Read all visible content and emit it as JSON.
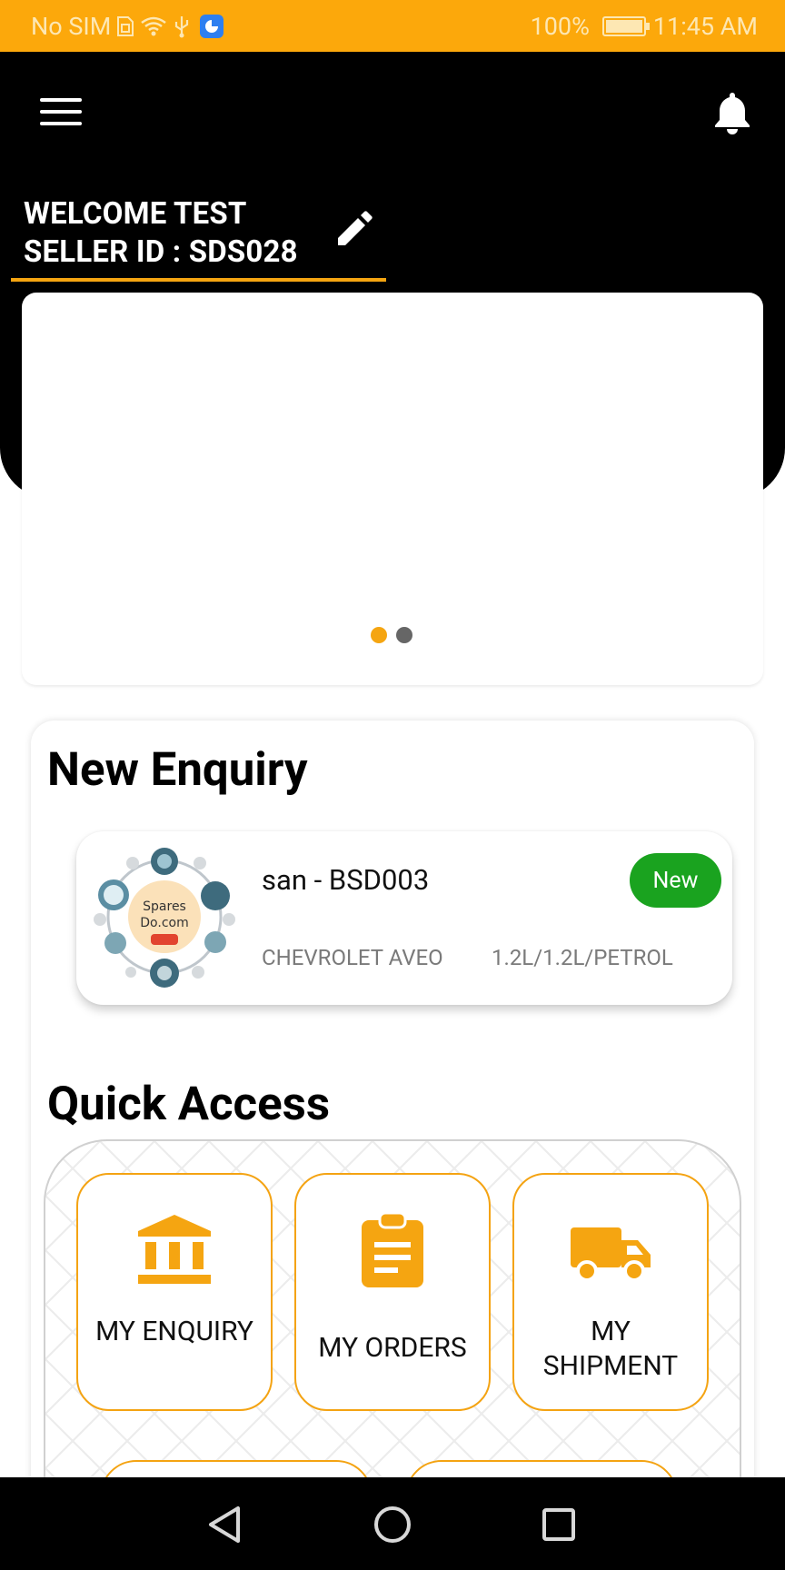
{
  "status_bar": {
    "left_text": "No SIM",
    "battery": "100%",
    "time": "11:45 AM"
  },
  "header": {
    "welcome": "WELCOME TEST",
    "seller_id": "SELLER ID : SDS028"
  },
  "banner": {
    "dots": [
      "active",
      "inactive"
    ]
  },
  "new_enquiry": {
    "title": "New Enquiry",
    "name": "san - BSD003",
    "vehicle": "CHEVROLET AVEO",
    "engine": "1.2L/1.2L/PETROL",
    "badge": "New",
    "logo_text": "Spares Do.com"
  },
  "quick_access": {
    "title": "Quick Access",
    "tiles": [
      {
        "label": "MY ENQUIRY",
        "icon": "bank-icon"
      },
      {
        "label": "MY ORDERS",
        "icon": "clipboard-icon"
      },
      {
        "label": "MY SHIPMENT",
        "icon": "truck-icon"
      }
    ]
  },
  "nav": {
    "buttons": [
      "back-icon",
      "home-icon",
      "recents-icon"
    ]
  },
  "colors": {
    "accent": "#f5a511",
    "badge_green": "#1aa31f",
    "status_bar": "#fca80b",
    "header": "#000000"
  }
}
